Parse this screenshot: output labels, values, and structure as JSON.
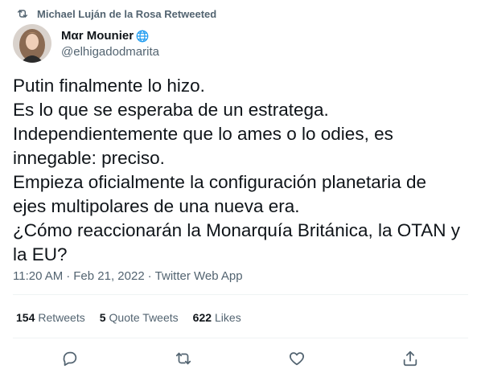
{
  "retweet_context": {
    "text": "Michael Luján de la Rosa Retweeted",
    "icon": "retweet-icon"
  },
  "author": {
    "display_name": "Mαr Mounier",
    "handle": "@elhigadodmarita",
    "badge_icon": "globe-icon"
  },
  "tweet": {
    "lines": [
      "Putin finalmente lo hizo.",
      "Es lo que se esperaba de un estratega.",
      "Independientemente que lo ames o lo odies, es",
      "innegable: preciso.",
      "Empieza oficialmente la configuración planetaria de",
      "ejes multipolares de una nueva era.",
      "¿Cómo reaccionarán la Monarquía Británica, la OTAN y",
      "la EU?"
    ]
  },
  "meta": {
    "time": "11:20 AM",
    "separator": "·",
    "date": "Feb 21, 2022",
    "source": "Twitter Web App"
  },
  "stats": {
    "retweets": {
      "count": "154",
      "label": "Retweets"
    },
    "quote_tweets": {
      "count": "5",
      "label": "Quote Tweets"
    },
    "likes": {
      "count": "622",
      "label": "Likes"
    }
  },
  "actions": [
    "reply-icon",
    "retweet-icon",
    "like-icon",
    "share-icon"
  ],
  "colors": {
    "text_primary": "#0f1419",
    "text_secondary": "#536471",
    "divider": "#eff3f4",
    "globe": "#1d9bf0"
  }
}
